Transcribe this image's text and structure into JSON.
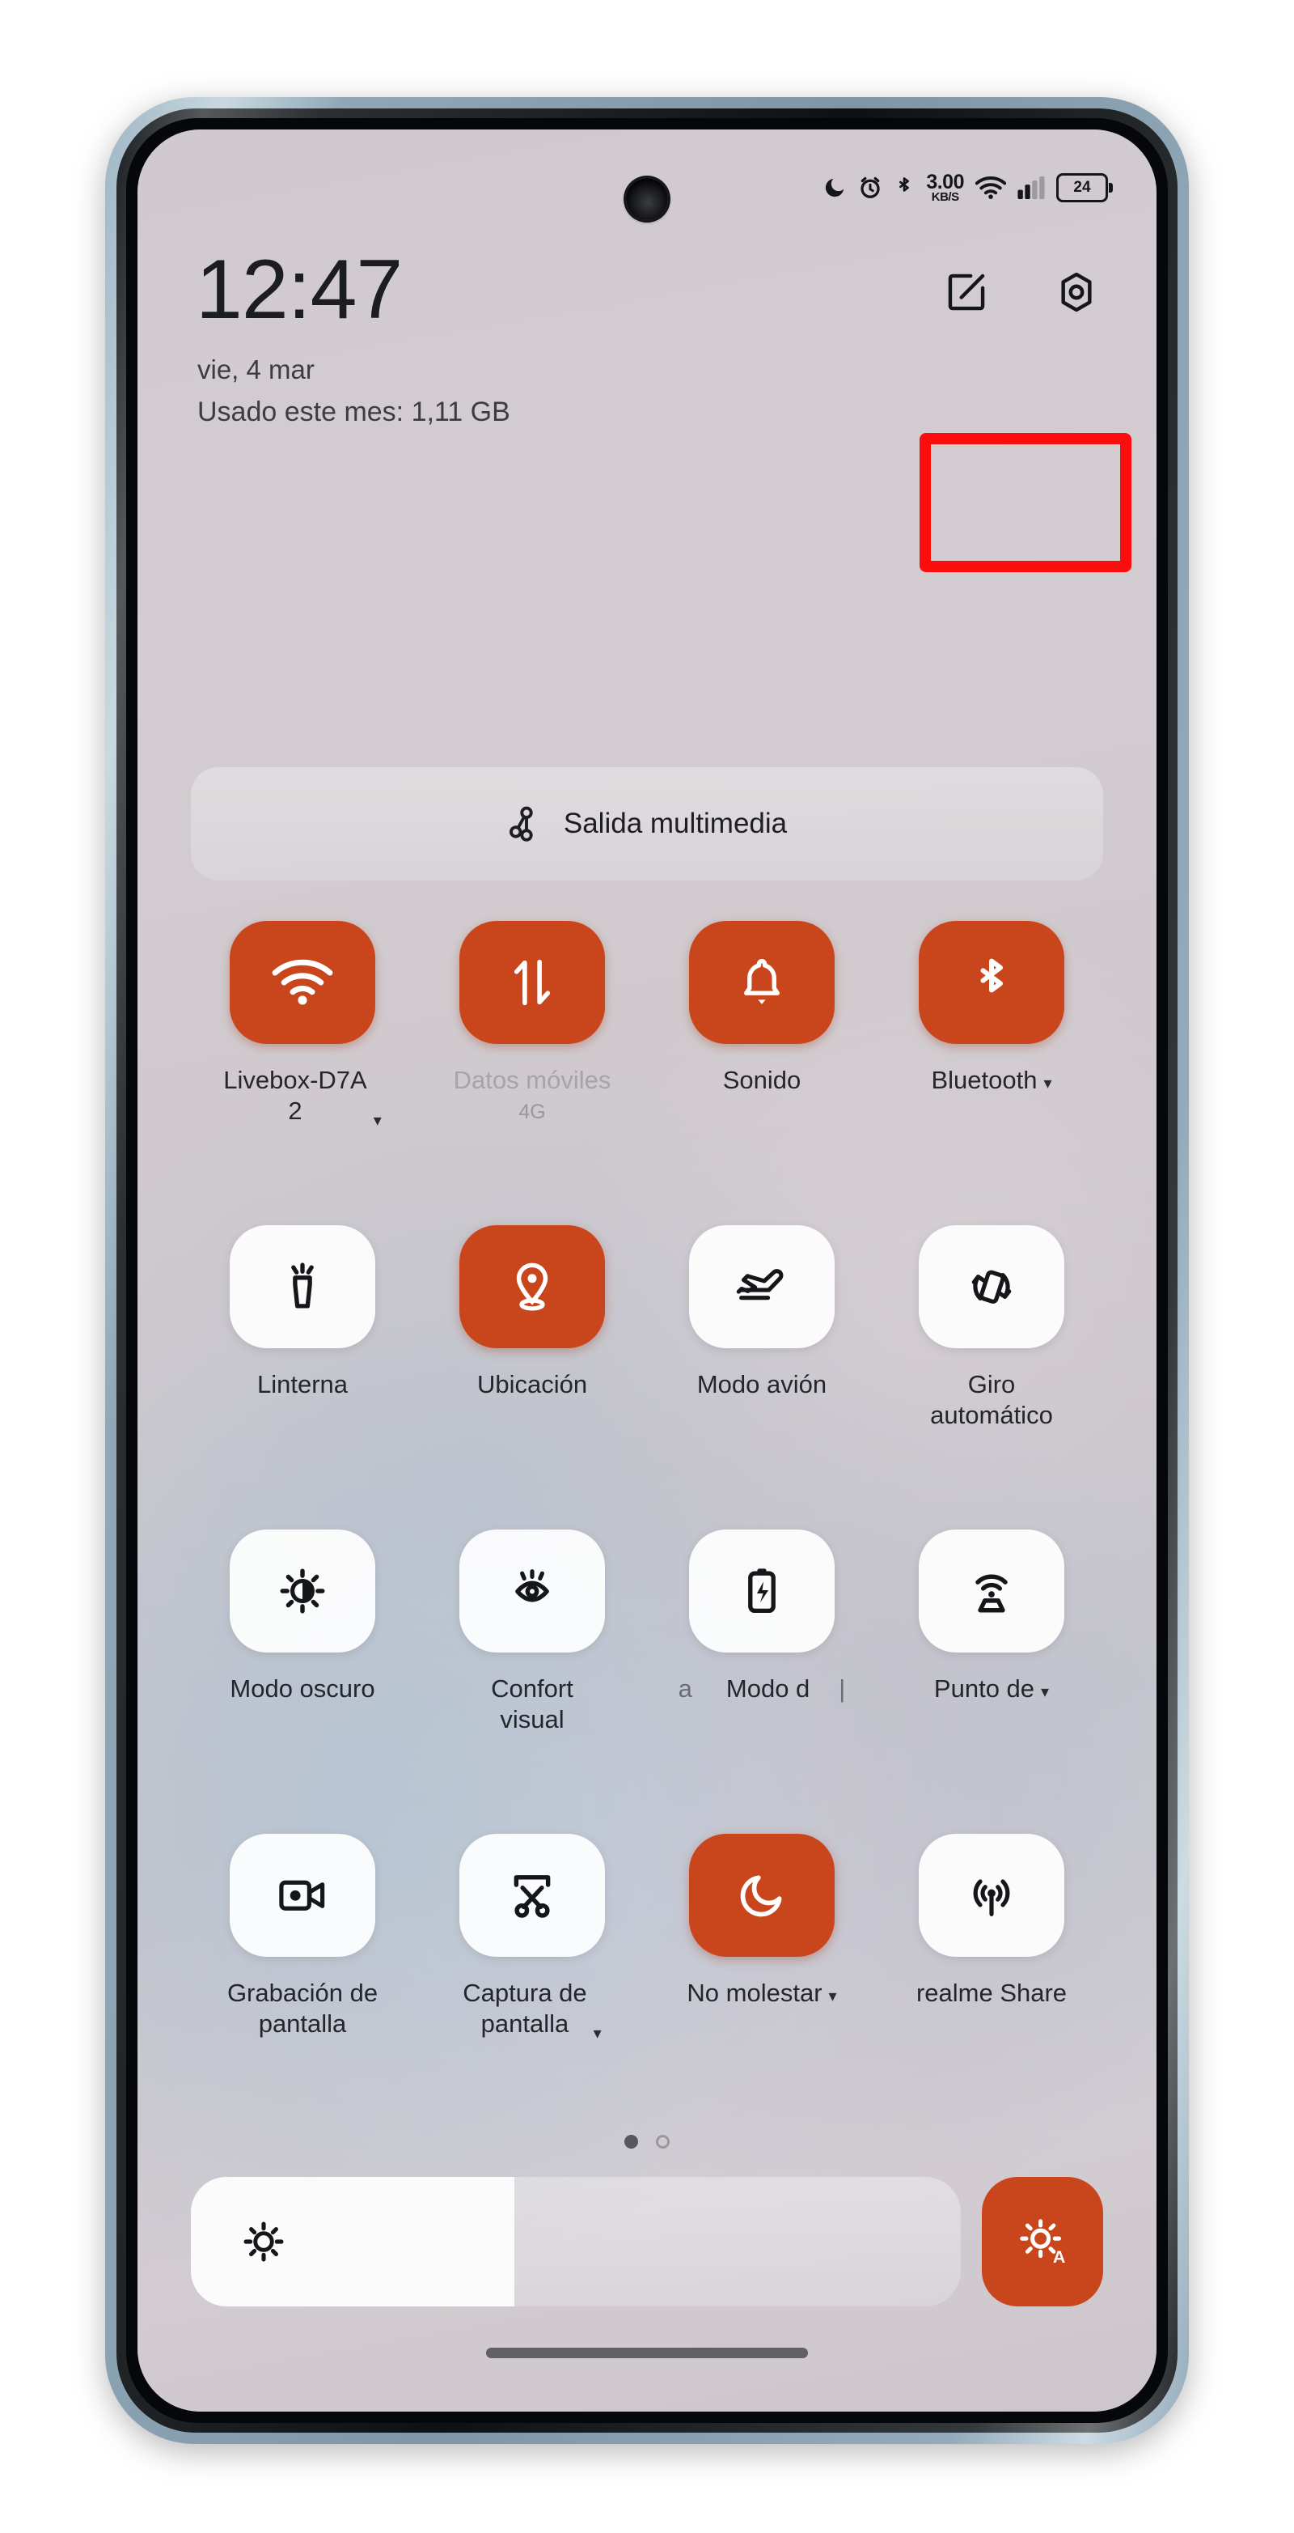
{
  "device": {
    "platform": "realme UI",
    "panel_name": "Quick Settings / Control Center"
  },
  "status_bar": {
    "icons": [
      {
        "name": "dnd-moon-icon",
        "glyph": "moon"
      },
      {
        "name": "alarm-icon",
        "glyph": "alarm"
      },
      {
        "name": "bluetooth-icon",
        "glyph": "bluetooth"
      }
    ],
    "network_speed": {
      "value": "3.00",
      "unit": "KB/S"
    },
    "wifi_icon": "wifi-icon",
    "signal_icon": "cellular-signal-icon",
    "battery": {
      "name": "battery-icon",
      "level": "24"
    }
  },
  "header": {
    "clock": "12:47",
    "date": "vie, 4 mar",
    "data_usage": "Usado este mes: 1,11 GB",
    "edit_button": {
      "name": "edit-quick-settings-button",
      "icon": "edit-square-pencil-icon"
    },
    "settings_button": {
      "name": "settings-button",
      "icon": "gear-hexagon-icon"
    }
  },
  "annotation": {
    "highlight_color": "#fc0d0d",
    "target": "edit-quick-settings-button"
  },
  "media_output": {
    "label": "Salida multimedia",
    "icon": "cast-media-output-icon"
  },
  "tiles": [
    {
      "label": "Livebox-D7A\n2",
      "sub": "",
      "icon": "wifi-icon",
      "active": true,
      "caret": true,
      "caret_low": true,
      "dim": false
    },
    {
      "label": "Datos móviles",
      "sub": "4G",
      "icon": "mobile-data-arrows-icon",
      "active": true,
      "caret": false,
      "caret_low": false,
      "dim": true
    },
    {
      "label": "Sonido",
      "sub": "",
      "icon": "bell-sound-icon",
      "active": true,
      "caret": false,
      "caret_low": false,
      "dim": false
    },
    {
      "label": "Bluetooth",
      "sub": "",
      "icon": "bluetooth-icon",
      "active": true,
      "caret": true,
      "caret_low": false,
      "dim": false
    },
    {
      "label": "Linterna",
      "sub": "",
      "icon": "flashlight-icon",
      "active": false,
      "caret": false,
      "caret_low": false,
      "dim": false
    },
    {
      "label": "Ubicación",
      "sub": "",
      "icon": "location-pin-icon",
      "active": true,
      "caret": false,
      "caret_low": false,
      "dim": false
    },
    {
      "label": "Modo avión",
      "sub": "",
      "icon": "airplane-icon",
      "active": false,
      "caret": false,
      "caret_low": false,
      "dim": false
    },
    {
      "label": "Giro\nautomático",
      "sub": "",
      "icon": "auto-rotate-icon",
      "active": false,
      "caret": false,
      "caret_low": false,
      "dim": false
    },
    {
      "label": "Modo oscuro",
      "sub": "",
      "icon": "dark-mode-sun-icon",
      "active": false,
      "caret": false,
      "caret_low": false,
      "dim": false
    },
    {
      "label": "Confort\nvisual",
      "sub": "",
      "icon": "eye-comfort-icon",
      "active": false,
      "caret": false,
      "caret_low": false,
      "dim": false
    },
    {
      "label": "Modo d",
      "sub": "",
      "icon": "battery-saver-icon",
      "active": false,
      "caret": false,
      "caret_low": false,
      "dim": false
    },
    {
      "label": "Punto de",
      "sub": "",
      "icon": "hotspot-router-icon",
      "active": false,
      "caret": true,
      "caret_low": false,
      "dim": false
    },
    {
      "label": "Grabación de\npantalla",
      "sub": "",
      "icon": "screen-record-icon",
      "active": false,
      "caret": false,
      "caret_low": false,
      "dim": false
    },
    {
      "label": "Captura de\npantalla",
      "sub": "",
      "icon": "screenshot-scissors-icon",
      "active": false,
      "caret": true,
      "caret_low": true,
      "dim": false
    },
    {
      "label": "No molestar",
      "sub": "",
      "icon": "dnd-moon-icon",
      "active": true,
      "caret": true,
      "caret_low": false,
      "dim": false
    },
    {
      "label": "realme Share",
      "sub": "",
      "icon": "realme-share-icon",
      "active": false,
      "caret": false,
      "caret_low": false,
      "dim": false
    }
  ],
  "tile_label_fragments": {
    "row3_left_fragment": "a",
    "row3_divider_fragment": "|"
  },
  "pagination": {
    "pages": 2,
    "current": 1
  },
  "brightness": {
    "name": "brightness-slider",
    "percent": 42,
    "icon": "brightness-sun-icon",
    "auto_button": {
      "name": "auto-brightness-button",
      "icon": "auto-brightness-sun-a-icon",
      "active": true
    }
  },
  "home_indicator": {
    "name": "home-indicator"
  },
  "colors": {
    "accent_orange": "#c9451b",
    "tile_off": "#ffffff",
    "text_primary": "#25262b",
    "annotation_red": "#fc0d0d"
  }
}
